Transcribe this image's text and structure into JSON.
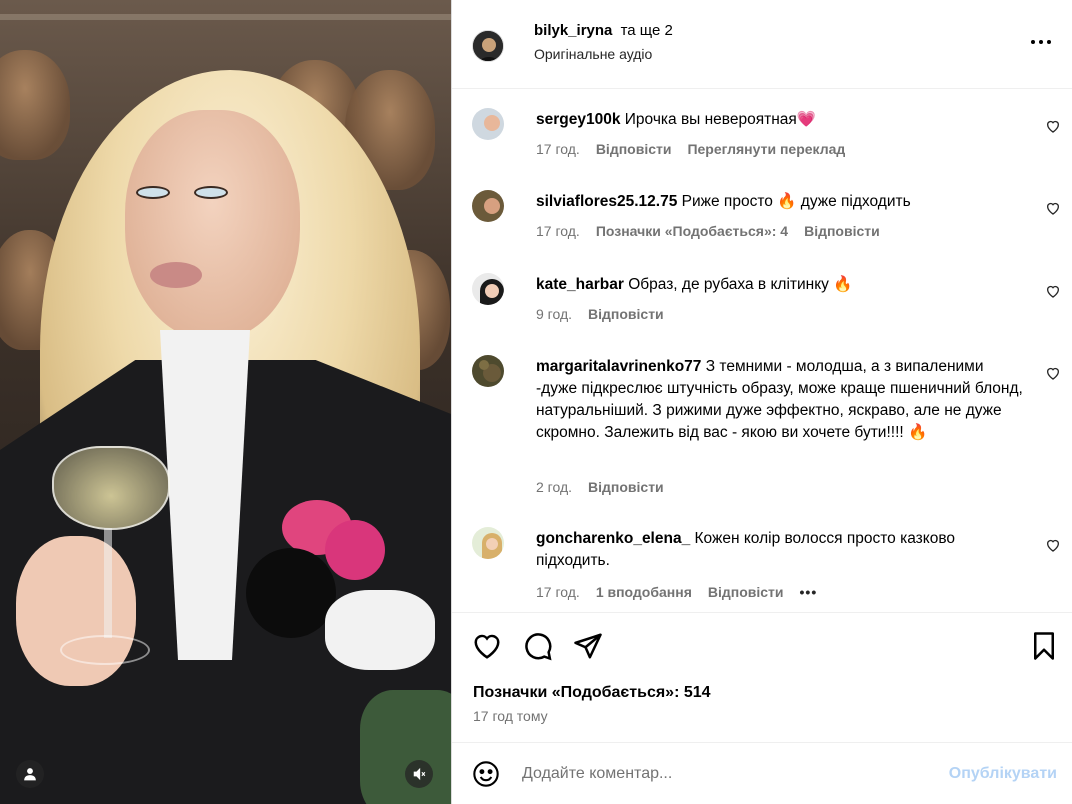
{
  "post": {
    "author": "bilyk_iryna",
    "coauthors": "та ще 2",
    "audio": "Оригінальне аудіо"
  },
  "comments": [
    {
      "user": "sergey100k",
      "text": "Ирочка вы невероятная💗",
      "time": "17 год.",
      "reply": "Відповісти",
      "extra": "Переглянути переклад",
      "avatar_color": "#7a8fa8"
    },
    {
      "user": "silviaflores25.12.75",
      "text": "Риже просто 🔥 дуже підходить",
      "time": "17 год.",
      "likes": "Позначки «Подобається»: 4",
      "reply": "Відповісти",
      "avatar_color": "#8a6b4a"
    },
    {
      "user": "kate_harbar",
      "text": "Образ, де рубаха в клітинку 🔥",
      "time": "9 год.",
      "reply": "Відповісти",
      "avatar_color": "#3a3a3a"
    },
    {
      "user": "margaritalavrinenko77",
      "text": "З темними - молодша, а з випаленими -дуже підкреслює штучність образу, може краще пшеничний блонд, натуральніший. З рижими дуже эффектно, яскраво, але не дуже скромно. Залежить від вас - якою ви хочете бути!!!! 🔥",
      "time": "2 год.",
      "reply": "Відповісти",
      "avatar_color": "#5b5a3a"
    },
    {
      "user": "goncharenko_elena_",
      "text": "Кожен колір волосся просто казково підходить.",
      "time": "17 год.",
      "likes": "1 вподобання",
      "reply": "Відповісти",
      "more": "•••",
      "avatar_color": "#c9a46a"
    }
  ],
  "footer": {
    "likes": "Позначки «Подобається»: 514",
    "time_ago": "17 год тому",
    "comment_placeholder": "Додайте коментар...",
    "publish": "Опублікувати"
  },
  "icons": {
    "more": "more-options-icon",
    "like": "heart-icon",
    "comment": "comment-icon",
    "share": "share-icon",
    "save": "bookmark-icon",
    "emoji": "emoji-icon",
    "user_tags": "user-icon",
    "mute": "speaker-muted-icon"
  },
  "colors": {
    "muted_text": "#737373",
    "publish_disabled": "#b4d3f5",
    "heart_emoji": "#e84393"
  }
}
